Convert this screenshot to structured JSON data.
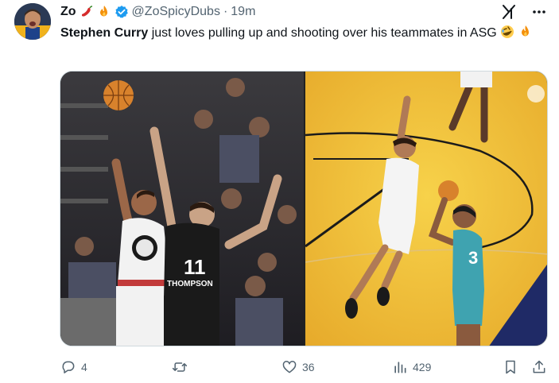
{
  "tweet": {
    "author": {
      "display_name": "Zo",
      "name_emojis": [
        "hot-pepper-emoji",
        "fire-emoji"
      ],
      "verified": true,
      "handle": "@ZoSpicyDubs",
      "separator": "·",
      "time": "19m"
    },
    "text": {
      "bold": "Stephen Curry",
      "rest": " just loves pulling up and shooting over his teammates in ASG",
      "trailing_emojis": [
        "rolling-on-floor-laughing-emoji",
        "fire-emoji"
      ]
    },
    "media": {
      "left_jersey_number": "11",
      "left_jersey_name": "THOMPSON",
      "right_jersey_number": "3"
    },
    "actions": {
      "reply_count": "4",
      "retweet_count": "",
      "like_count": "36",
      "views_count": "429"
    }
  },
  "colors": {
    "text_primary": "#0f1419",
    "text_secondary": "#536471",
    "verified_blue": "#1d9bf0",
    "court_yellow": "#f2c437",
    "jersey_teal": "#3fa3b0"
  }
}
